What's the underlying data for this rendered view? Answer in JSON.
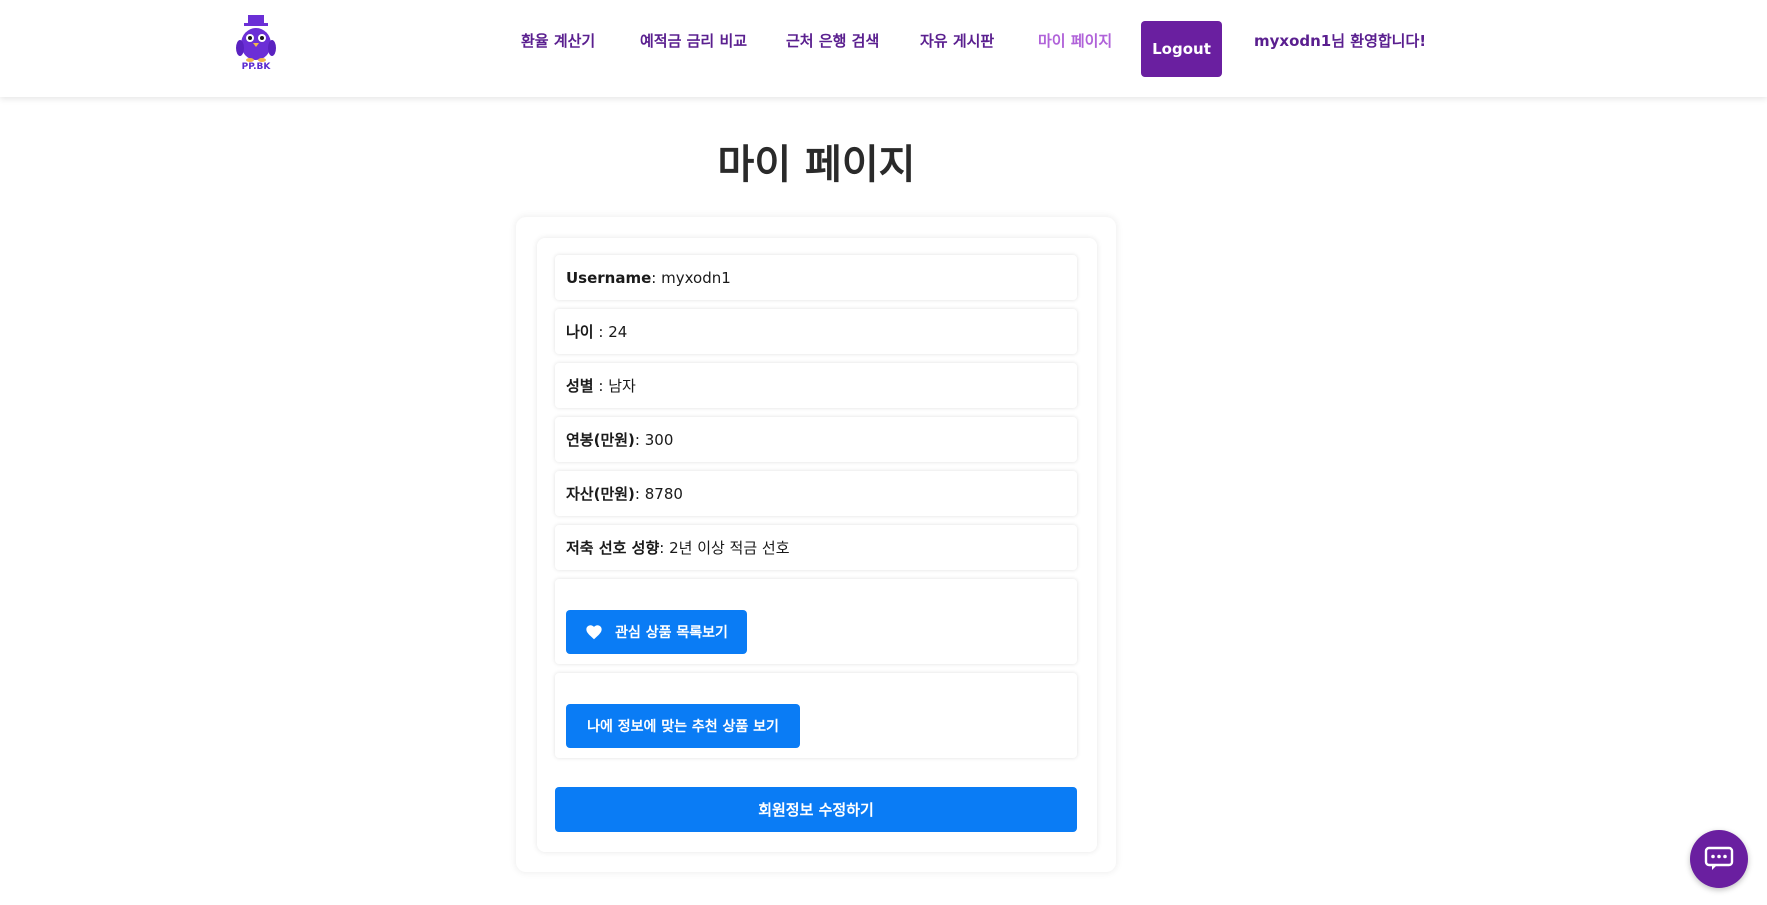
{
  "header": {
    "logo_text": "PP.BK",
    "nav": [
      {
        "label": "환율 계산기"
      },
      {
        "label": "예적금 금리 비교"
      },
      {
        "label": "근처 은행 검색"
      },
      {
        "label": "자유 게시판"
      },
      {
        "label": "마이 페이지"
      }
    ],
    "logout_label": "Logout",
    "welcome_text": "myxodn1님 환영합니다!"
  },
  "page": {
    "title": "마이 페이지"
  },
  "profile": {
    "rows": [
      {
        "label": "Username",
        "sep": ": ",
        "value": "myxodn1"
      },
      {
        "label": "나이",
        "sep": " : ",
        "value": "24"
      },
      {
        "label": "성별",
        "sep": " : ",
        "value": "남자"
      },
      {
        "label": "연봉(만원)",
        "sep": ": ",
        "value": "300"
      },
      {
        "label": "자산(만원)",
        "sep": ": ",
        "value": "8780"
      },
      {
        "label": "저축 선호 성향",
        "sep": ": ",
        "value": "2년 이상 적금 선호"
      }
    ],
    "wishlist_button": "관심 상품 목록보기",
    "recommend_button": "나에 정보에 맞는 추천 상품 보기",
    "edit_button": "회원정보 수정하기"
  },
  "colors": {
    "brand_purple": "#6a1fa0",
    "nav_text": "#5a1f8f",
    "nav_active": "#b062d9",
    "primary_blue": "#0a7cf5"
  },
  "icons": {
    "logo": "penguin-logo-icon",
    "wishlist": "heart-icon",
    "chat": "chat-bubble-icon"
  }
}
